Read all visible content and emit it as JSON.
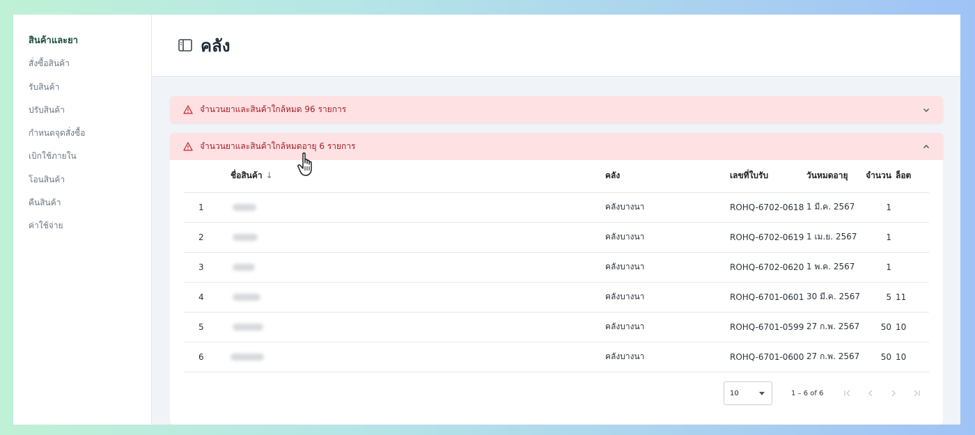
{
  "sidebar": {
    "items": [
      {
        "label": "สินค้าและยา",
        "active": true
      },
      {
        "label": "สั่งซื้อสินค้า"
      },
      {
        "label": "รับสินค้า"
      },
      {
        "label": "ปรับสินค้า"
      },
      {
        "label": "กำหนดจุดสั่งซื้อ"
      },
      {
        "label": "เบิกใช้ภายใน"
      },
      {
        "label": "โอนสินค้า"
      },
      {
        "label": "คืนสินค้า"
      },
      {
        "label": "ค่าใช้จ่าย"
      }
    ]
  },
  "header": {
    "title": "คลัง",
    "icon": "panel-icon"
  },
  "alerts": [
    {
      "text": "จำนวนยาและสินค้าใกล้หมด 96 รายการ",
      "expanded": false,
      "icon": "warning-icon"
    },
    {
      "text": "จำนวนยาและสินค้าใกล้หมดอายุ 6 รายการ",
      "expanded": true,
      "icon": "warning-icon"
    }
  ],
  "table": {
    "columns": [
      "ชื่อสินค้า",
      "คลัง",
      "เลขที่ใบรับ",
      "วันหมดอายุ",
      "จำนวน",
      "ล็อต"
    ],
    "rows": [
      {
        "index": "1",
        "warehouse": "คลังบางนา",
        "receipt": "ROHQ-6702-0618",
        "expiry": "1 มี.ค. 2567",
        "qty": "1",
        "lot": ""
      },
      {
        "index": "2",
        "warehouse": "คลังบางนา",
        "receipt": "ROHQ-6702-0619",
        "expiry": "1 เม.ย. 2567",
        "qty": "1",
        "lot": ""
      },
      {
        "index": "3",
        "warehouse": "คลังบางนา",
        "receipt": "ROHQ-6702-0620",
        "expiry": "1 พ.ค. 2567",
        "qty": "1",
        "lot": ""
      },
      {
        "index": "4",
        "warehouse": "คลังบางนา",
        "receipt": "ROHQ-6701-0601",
        "expiry": "30 มี.ค. 2567",
        "qty": "5",
        "lot": "11"
      },
      {
        "index": "5",
        "warehouse": "คลังบางนา",
        "receipt": "ROHQ-6701-0599",
        "expiry": "27 ก.พ. 2567",
        "qty": "50",
        "lot": "10"
      },
      {
        "index": "6",
        "warehouse": "คลังบางนา",
        "receipt": "ROHQ-6701-0600",
        "expiry": "27 ก.พ. 2567",
        "qty": "50",
        "lot": "10"
      }
    ]
  },
  "pagination": {
    "page_size": "10",
    "range": "1 – 6 of 6"
  },
  "colors": {
    "accent": "#1b4e3a",
    "alert_bg": "#fde1e3",
    "alert_text": "#a32028",
    "content_bg": "#f0f3f7"
  }
}
